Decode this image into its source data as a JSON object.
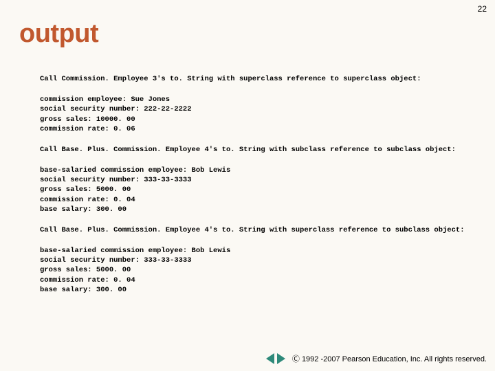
{
  "pageNumber": "22",
  "title": "output",
  "blocks": [
    "Call Commission. Employee 3's to. String with superclass reference to superclass object:",
    "commission employee: Sue Jones\nsocial security number: 222-22-2222\ngross sales: 10000. 00\ncommission rate: 0. 06",
    "Call Base. Plus. Commission. Employee 4's to. String with subclass reference to subclass object:",
    "base-salaried commission employee: Bob Lewis\nsocial security number: 333-33-3333\ngross sales: 5000. 00\ncommission rate: 0. 04\nbase salary: 300. 00",
    "Call Base. Plus. Commission. Employee 4's to. String with superclass reference to subclass object:",
    "base-salaried commission employee: Bob Lewis\nsocial security number: 333-33-3333\ngross sales: 5000. 00\ncommission rate: 0. 04\nbase salary: 300. 00"
  ],
  "footer": {
    "copyright": "1992 -2007 Pearson Education, Inc. All rights reserved."
  }
}
